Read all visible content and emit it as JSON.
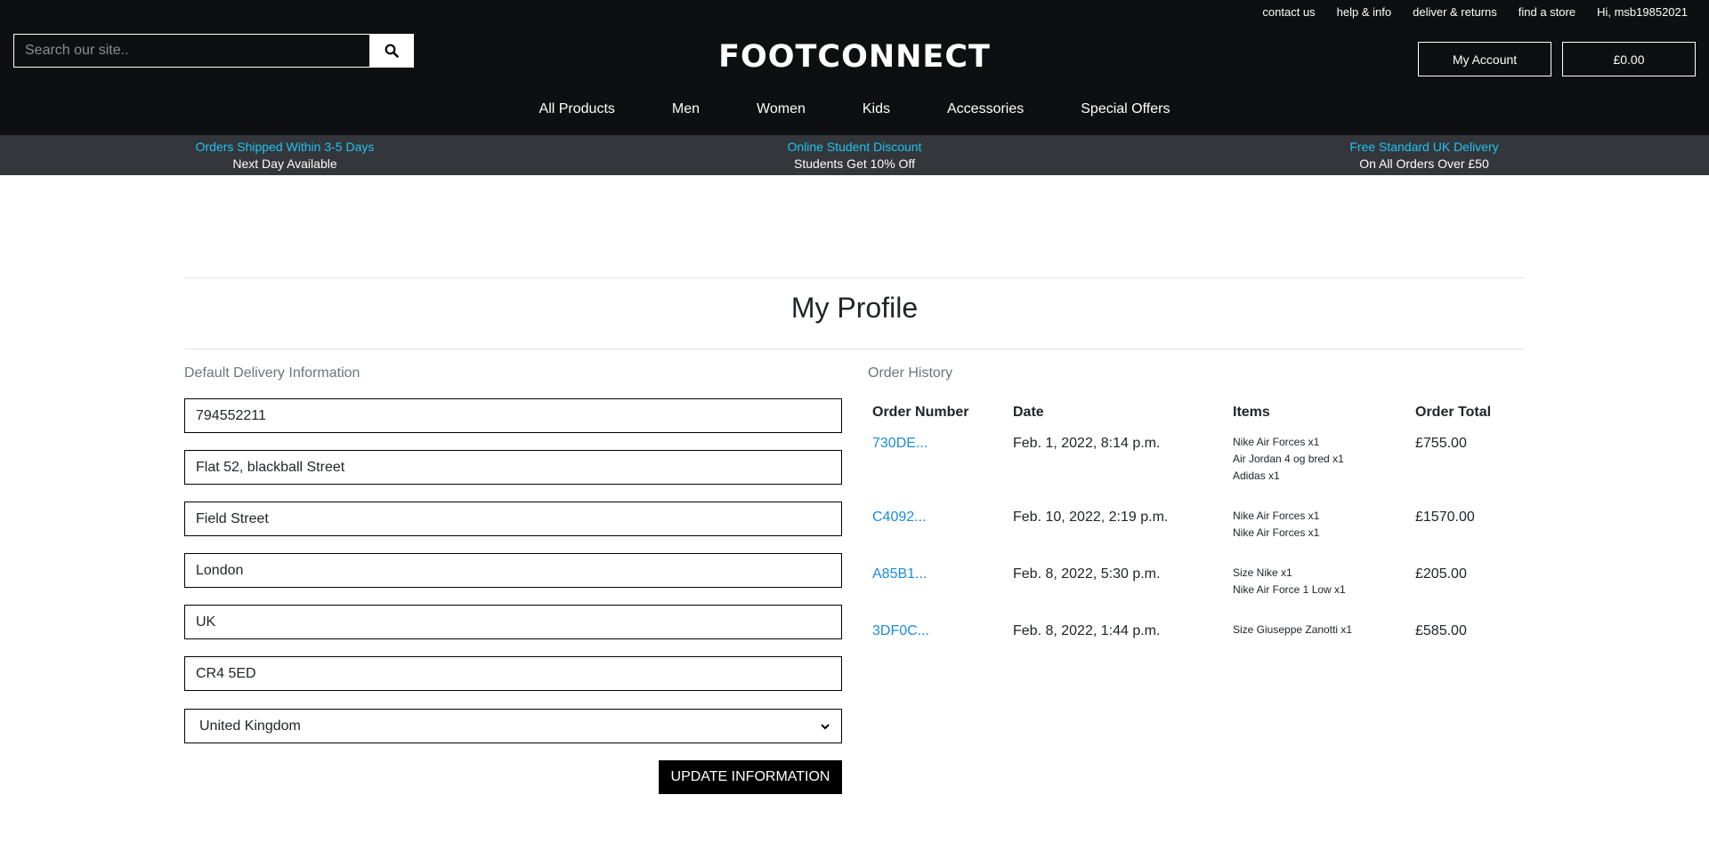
{
  "top_links": [
    "contact us",
    "help & info",
    "deliver & returns",
    "find a store",
    "Hi, msb19852021"
  ],
  "search": {
    "placeholder": "Search our site.."
  },
  "brand": {
    "logo": "FOOTCONNECT"
  },
  "account_button": "My Account",
  "cart_button": "£0.00",
  "nav": [
    "All Products",
    "Men",
    "Women",
    "Kids",
    "Accessories",
    "Special Offers"
  ],
  "promos": [
    {
      "line1": "Orders Shipped Within 3-5 Days",
      "line2": "Next Day Available"
    },
    {
      "line1": "Online Student Discount",
      "line2": "Students Get 10% Off"
    },
    {
      "line1": "Free Standard UK Delivery",
      "line2": "On All Orders Over £50"
    }
  ],
  "page_title": "My Profile",
  "delivery": {
    "label": "Default Delivery Information",
    "phone": "794552211",
    "street1": "Flat 52, blackball Street",
    "street2": "Field Street",
    "town": "London",
    "county": "UK",
    "postcode": "CR4 5ED",
    "country": "United Kingdom",
    "update_button": "UPDATE INFORMATION"
  },
  "orders": {
    "label": "Order History",
    "headers": [
      "Order Number",
      "Date",
      "Items",
      "Order Total"
    ],
    "rows": [
      {
        "number": "730DE...",
        "date": "Feb. 1, 2022, 8:14 p.m.",
        "items": [
          "Nike Air Forces x1",
          "Air Jordan 4 og bred x1",
          "Adidas x1"
        ],
        "total": "£755.00"
      },
      {
        "number": "C4092...",
        "date": "Feb. 10, 2022, 2:19 p.m.",
        "items": [
          "Nike Air Forces x1",
          "Nike Air Forces x1"
        ],
        "total": "£1570.00"
      },
      {
        "number": "A85B1...",
        "date": "Feb. 8, 2022, 5:30 p.m.",
        "items": [
          "Size Nike x1",
          "Nike Air Force 1 Low x1"
        ],
        "total": "£205.00"
      },
      {
        "number": "3DF0C...",
        "date": "Feb. 8, 2022, 1:44 p.m.",
        "items": [
          "Size Giuseppe Zanotti x1"
        ],
        "total": "£585.00"
      }
    ]
  },
  "colors": {
    "header_bg": "#0d0f12",
    "promo_bg": "#33363a",
    "promo_accent": "#1fc4f1",
    "link": "#1a8be0"
  }
}
